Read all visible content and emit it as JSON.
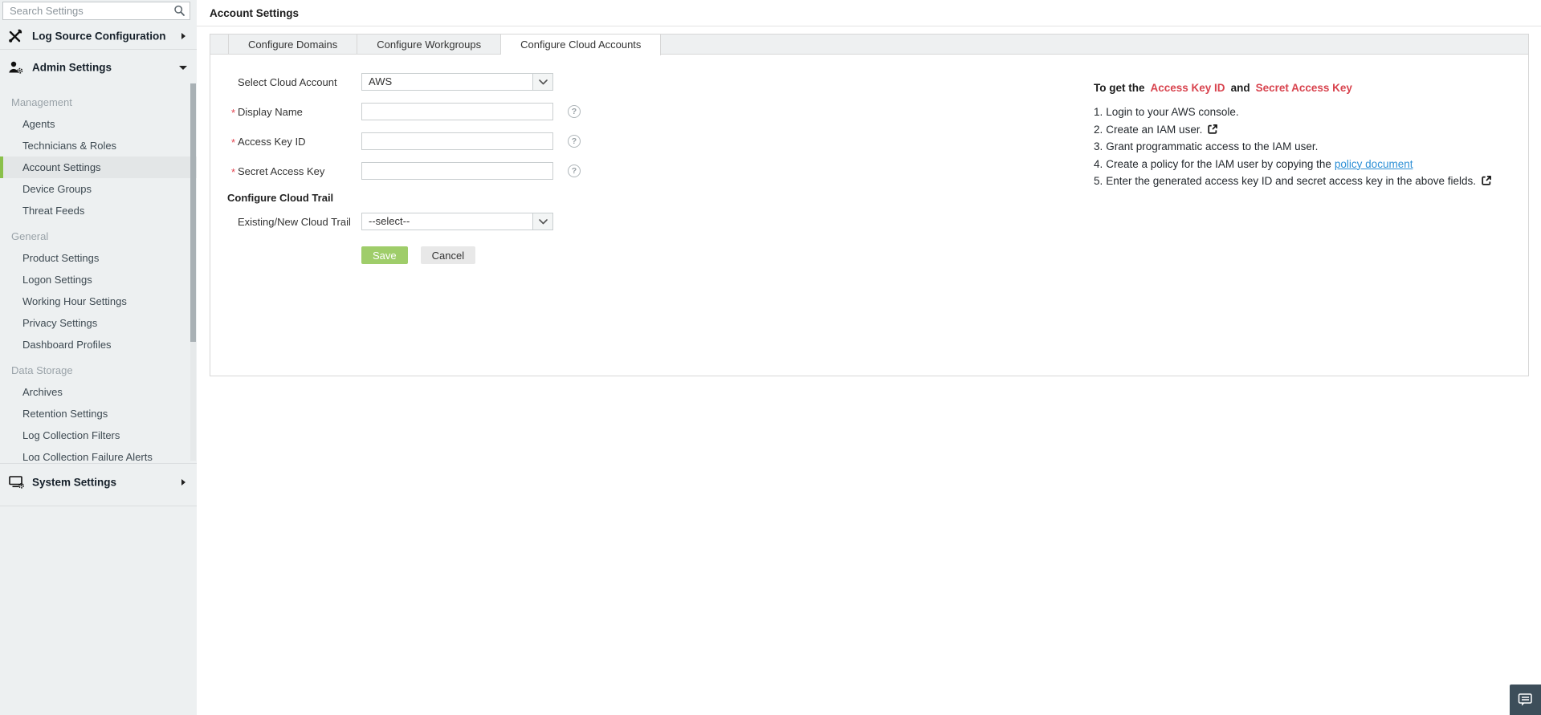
{
  "colors": {
    "sidebar_bg": "#edf0f1",
    "active_item_green": "#8ac04a",
    "active_item_bg": "#e3e6e7",
    "required_red": "#e2434f",
    "instruction_red": "#d8434e",
    "link_blue": "#2e90d6",
    "save_green": "#9fcd6a",
    "chat_button_bg": "#3d4e5a"
  },
  "sidebar": {
    "search": {
      "placeholder": "Search Settings"
    },
    "log_source_configuration": {
      "label": "Log Source Configuration"
    },
    "admin_settings": {
      "label": "Admin Settings"
    },
    "sections": [
      {
        "label": "Management",
        "items": [
          {
            "label": "Agents"
          },
          {
            "label": "Technicians & Roles"
          },
          {
            "label": "Account Settings",
            "active": true
          },
          {
            "label": "Device Groups"
          },
          {
            "label": "Threat Feeds"
          }
        ]
      },
      {
        "label": "General",
        "items": [
          {
            "label": "Product Settings"
          },
          {
            "label": "Logon Settings"
          },
          {
            "label": "Working Hour Settings"
          },
          {
            "label": "Privacy Settings"
          },
          {
            "label": "Dashboard Profiles"
          }
        ]
      },
      {
        "label": "Data Storage",
        "items": [
          {
            "label": "Archives"
          },
          {
            "label": "Retention Settings"
          },
          {
            "label": "Log Collection Filters"
          },
          {
            "label": "Log Collection Failure Alerts"
          }
        ]
      }
    ],
    "system_settings": {
      "label": "System Settings"
    }
  },
  "main": {
    "title": "Account Settings",
    "tabs": [
      {
        "label": "Configure Domains",
        "active": false
      },
      {
        "label": "Configure Workgroups",
        "active": false
      },
      {
        "label": "Configure Cloud Accounts",
        "active": true
      }
    ],
    "form": {
      "required_marker": "*",
      "cloud_account_label": "Select Cloud Account",
      "cloud_account_value": "AWS",
      "display_name_label": "Display Name",
      "display_name_value": "",
      "access_key_id_label": "Access Key ID",
      "access_key_id_value": "",
      "secret_access_key_label": "Secret Access Key",
      "secret_access_key_value": "",
      "cloud_trail_heading": "Configure Cloud Trail",
      "cloud_trail_label": "Existing/New Cloud Trail",
      "cloud_trail_value": "--select--",
      "save_label": "Save",
      "cancel_label": "Cancel"
    },
    "instructions": {
      "title_prefix": "To get the",
      "title_key1": "Access Key ID",
      "title_and": "and",
      "title_key2": "Secret Access Key",
      "steps": [
        {
          "num": "1.",
          "text": "Login to your AWS console."
        },
        {
          "num": "2.",
          "text": "Create an IAM user.",
          "icon": "external-link-icon"
        },
        {
          "num": "3.",
          "text": "Grant programmatic access to the IAM user."
        },
        {
          "num": "4.",
          "text": "Create a policy for the IAM user by copying the",
          "link_text": "policy document"
        },
        {
          "num": "5.",
          "text": "Enter the generated access key ID and secret access key in the above fields.",
          "icon": "external-link-icon"
        }
      ]
    }
  }
}
